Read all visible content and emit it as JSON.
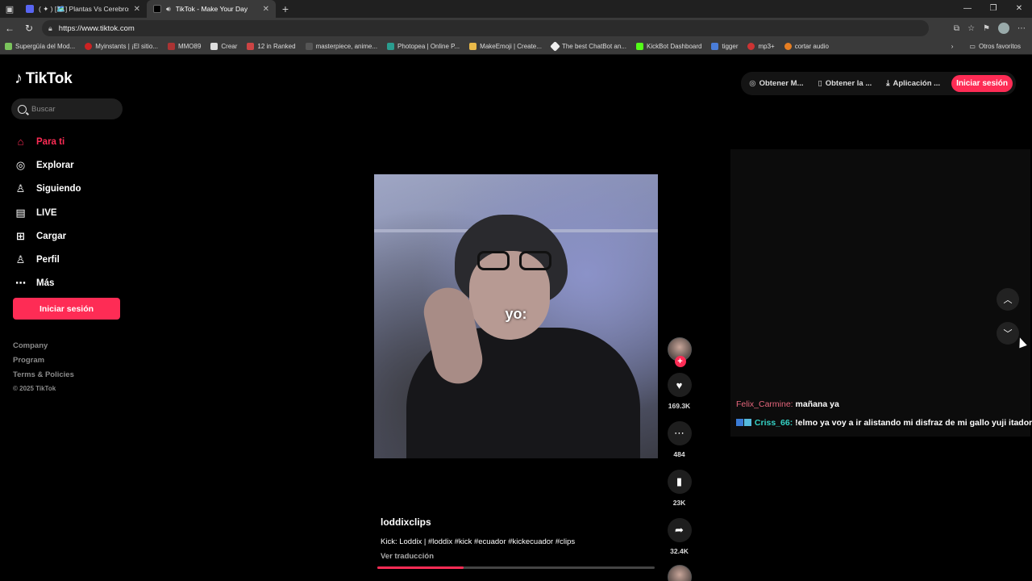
{
  "browser": {
    "tabs": [
      {
        "title": "( ✦ ) [🗺️] Plantas Vs Cerebros 🧠",
        "active": false
      },
      {
        "title": "TikTok - Make Your Day",
        "active": true
      }
    ],
    "url": "https://www.tiktok.com",
    "bookmarks": [
      "Supergüía del Mod...",
      "Myinstants | ¡El sitio...",
      "MMO89",
      "Crear",
      "12 in Ranked",
      "masterpiece, anime...",
      "Photopea | Online P...",
      "MakeEmoji | Create...",
      "The best ChatBot an...",
      "KickBot Dashboard",
      "tigger",
      "mp3+",
      "cortar audio"
    ],
    "other_bookmarks": "Otros favoritos"
  },
  "tiktok": {
    "logo": "TikTok",
    "search_placeholder": "Buscar",
    "nav": [
      {
        "label": "Para ti",
        "icon": "home-icon",
        "active": true
      },
      {
        "label": "Explorar",
        "icon": "compass-icon"
      },
      {
        "label": "Siguiendo",
        "icon": "following-icon"
      },
      {
        "label": "LIVE",
        "icon": "live-icon"
      },
      {
        "label": "Cargar",
        "icon": "upload-icon"
      },
      {
        "label": "Perfil",
        "icon": "profile-icon"
      },
      {
        "label": "Más",
        "icon": "more-icon"
      }
    ],
    "login_label": "Iniciar sesión",
    "footer": [
      "Company",
      "Program",
      "Terms & Policies"
    ],
    "copyright": "© 2025 TikTok",
    "top_actions": [
      "Obtener M...",
      "Obtener la ...",
      "Aplicación ..."
    ],
    "top_login": "Iniciar sesión",
    "video": {
      "overlay_text": "yo:",
      "username": "loddixclips",
      "description": "Kick: Loddix | #loddix #kick #ecuador #kickecuador #clips",
      "translate": "Ver traducción",
      "progress": 0.31
    },
    "stats": {
      "likes": "169.3K",
      "comments": "484",
      "saves": "23K",
      "shares": "32.4K"
    },
    "chat": [
      {
        "user": "Felix_Carmine:",
        "text": "mañana ya"
      },
      {
        "user": "Criss_66:",
        "text": "!elmo ya voy a ir alistando mi disfraz de mi gallo yuji itadori"
      }
    ],
    "colors": {
      "accent": "#fe2c55",
      "chat_user1": "#e7667c",
      "chat_user2": "#35d3c6"
    }
  }
}
